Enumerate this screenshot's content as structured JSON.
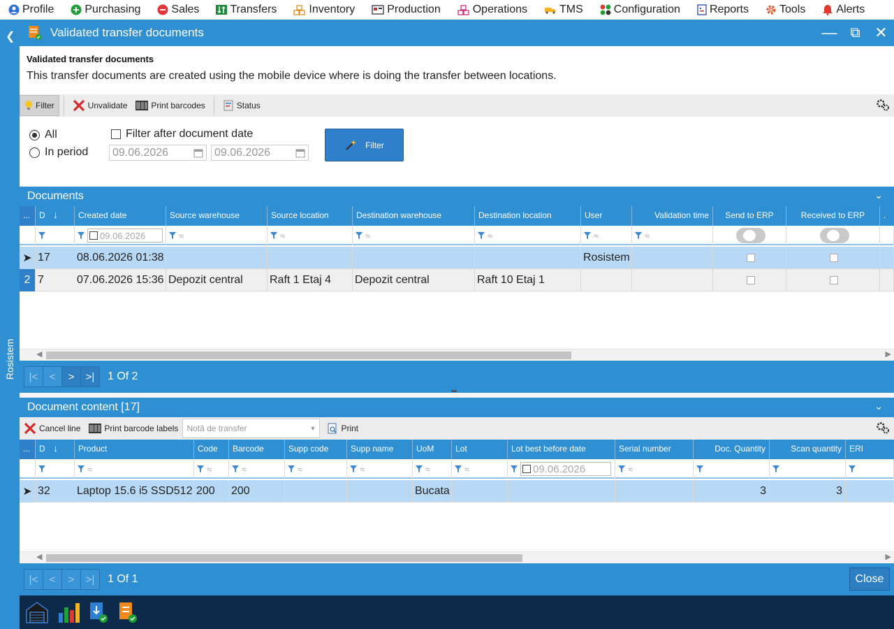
{
  "menu": {
    "items": [
      {
        "label": "Profile",
        "icon": "profile-icon"
      },
      {
        "label": "Purchasing",
        "icon": "plus-circle-icon"
      },
      {
        "label": "Sales",
        "icon": "minus-circle-icon"
      },
      {
        "label": "Transfers",
        "icon": "transfer-icon"
      },
      {
        "label": "Inventory",
        "icon": "inventory-icon"
      },
      {
        "label": "Production",
        "icon": "production-icon"
      },
      {
        "label": "Operations",
        "icon": "operations-icon"
      },
      {
        "label": "TMS",
        "icon": "truck-icon"
      },
      {
        "label": "Configuration",
        "icon": "configuration-icon"
      },
      {
        "label": "Reports",
        "icon": "reports-icon"
      },
      {
        "label": "Tools",
        "icon": "tools-icon"
      },
      {
        "label": "Alerts",
        "icon": "bell-icon"
      }
    ]
  },
  "sidebar": {
    "vertical_label": "Rosistem"
  },
  "window": {
    "title": "Validated transfer documents"
  },
  "header": {
    "title": "Validated transfer documents",
    "description": "This transfer documents are created using the mobile device where is doing the transfer between locations."
  },
  "toolbar": {
    "filter": "Filter",
    "unvalidate": "Unvalidate",
    "print_barcodes": "Print barcodes",
    "status": "Status"
  },
  "filter_panel": {
    "all": "All",
    "in_period": "In period",
    "filter_after_date": "Filter after document date",
    "date_from": "09.06.2026",
    "date_to": "09.06.2026",
    "filter_button": "Filter"
  },
  "documents": {
    "title": "Documents",
    "columns": [
      "...",
      "D",
      "",
      "Created date",
      "Source warehouse",
      "Source location",
      "Destination warehouse",
      "Destination location",
      "User",
      "Validation time",
      "Send to ERP",
      "Received to ERP",
      "."
    ],
    "filter_date": "09.06.2026",
    "rows": [
      {
        "ind": "",
        "d": "17",
        "created": "08.06.2026 01:38",
        "src_wh": "",
        "src_loc": "",
        "dst_wh": "",
        "dst_loc": "",
        "user": "Rosistem",
        "val_time": ""
      },
      {
        "ind": "2",
        "d": "7",
        "created": "07.06.2026 15:36",
        "src_wh": "Depozit central",
        "src_loc": "Raft 1 Etaj 4",
        "dst_wh": "Depozit central",
        "dst_loc": "Raft 10 Etaj 1",
        "user": "",
        "val_time": ""
      }
    ],
    "pager": {
      "first": "|<",
      "prev": "<",
      "next": ">",
      "last": ">|",
      "info": "1 Of 2"
    }
  },
  "content": {
    "title": "Document content [17]",
    "toolbar": {
      "cancel_line": "Cancel line",
      "print_labels": "Print barcode labels",
      "combo_placeholder": "Notă de transfer",
      "print": "Print"
    },
    "columns": [
      "...",
      "D",
      "",
      "Product",
      "Code",
      "Barcode",
      "Supp code",
      "Supp name",
      "UoM",
      "Lot",
      "Lot best before date",
      "Serial number",
      "Doc. Quantity",
      "Scan quantity",
      "ERI"
    ],
    "filter_date": "09.06.2026",
    "rows": [
      {
        "d": "32",
        "product": "Laptop 15.6 i5 SSD512",
        "code": "200",
        "barcode": "200",
        "supp_code": "",
        "supp_name": "",
        "uom": "Bucata",
        "lot": "",
        "lot_bbd": "",
        "serial": "",
        "doc_qty": "3",
        "scan_qty": "3"
      }
    ],
    "pager": {
      "first": "|<",
      "prev": "<",
      "next": ">",
      "last": ">|",
      "info": "1 Of 1",
      "close": "Close"
    }
  },
  "colors": {
    "accent": "#2f8fd3",
    "selected_row": "#b8d9f6",
    "taskbar": "#0e2a4a"
  }
}
